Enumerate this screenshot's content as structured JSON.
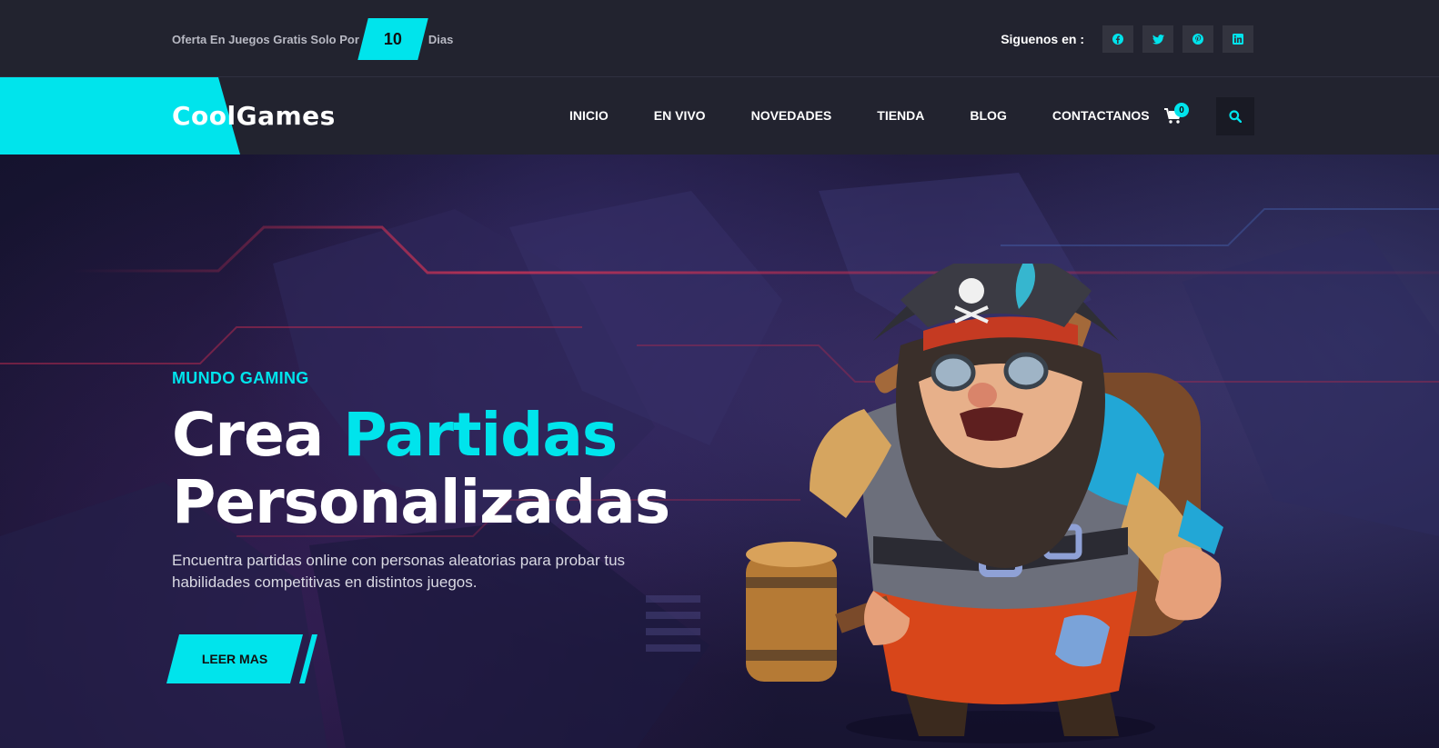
{
  "topbar": {
    "offer_text": "Oferta En Juegos Gratis Solo Por",
    "offer_days": "10",
    "offer_unit": "Dias",
    "follow_label": "Siguenos en :",
    "social": [
      {
        "icon": "facebook-icon",
        "glyph": "f"
      },
      {
        "icon": "twitter-icon",
        "glyph": "t"
      },
      {
        "icon": "pinterest-icon",
        "glyph": "p"
      },
      {
        "icon": "linkedin-icon",
        "glyph": "in"
      }
    ]
  },
  "navbar": {
    "logo": "CoolGames",
    "links": [
      "INICIO",
      "EN VIVO",
      "NOVEDADES",
      "TIENDA",
      "BLOG",
      "CONTACTANOS"
    ],
    "cart_count": "0"
  },
  "hero": {
    "eyebrow": "MUNDO GAMING",
    "title_line1_plain": "Crea ",
    "title_line1_accent": "Partidas",
    "title_line2": "Personalizadas",
    "description": "Encuentra partidas online con personas aleatorias para probar tus habilidades competitivas en distintos juegos.",
    "cta_label": "LEER MAS"
  },
  "colors": {
    "accent": "#00e4ec",
    "bar": "#22232f"
  }
}
